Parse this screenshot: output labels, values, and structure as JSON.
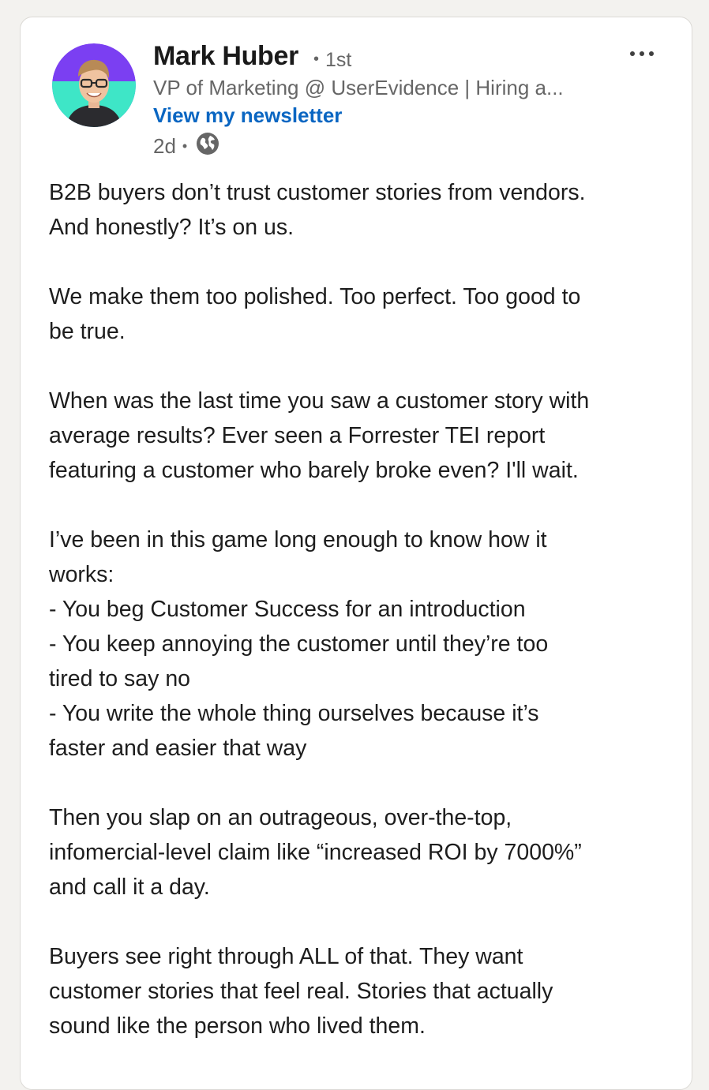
{
  "author": {
    "name": "Mark Huber",
    "degree": "1st",
    "headline": "VP of Marketing @ UserEvidence | Hiring a...",
    "newsletter_label": "View my newsletter",
    "timestamp": "2d",
    "visibility_icon": "globe-icon"
  },
  "menu": {
    "icon": "more-options-icon"
  },
  "post": {
    "paragraphs": [
      {
        "lines": [
          "B2B buyers don’t trust customer stories from vendors.",
          "And honestly? It’s on us."
        ]
      },
      {
        "lines": [
          "We make them too polished. Too perfect. Too good to",
          "be true."
        ]
      },
      {
        "lines": [
          "When was the last time you saw a customer story with",
          "average results? Ever seen a Forrester TEI report",
          "featuring a customer who barely broke even? I'll wait."
        ]
      },
      {
        "lines": [
          "I’ve been in this game long enough to know how it",
          "works:",
          "- You beg Customer Success for an introduction",
          "- You keep annoying the customer until they’re too",
          "tired to say no",
          "- You write the whole thing ourselves because it’s",
          "faster and easier that way"
        ]
      },
      {
        "lines": [
          "Then you slap on an outrageous, over-the-top,",
          "infomercial-level claim like “increased ROI by 7000%”",
          "and call it a day."
        ]
      },
      {
        "lines": [
          "Buyers see right through ALL of that. They want",
          "customer stories that feel real. Stories that actually",
          "sound like the person who lived them."
        ]
      }
    ]
  },
  "colors": {
    "link": "#0a66c2",
    "secondary_text": "#666666",
    "avatar_bg_purple": "#7b3ff2",
    "avatar_bg_teal": "#3ee6c7"
  }
}
